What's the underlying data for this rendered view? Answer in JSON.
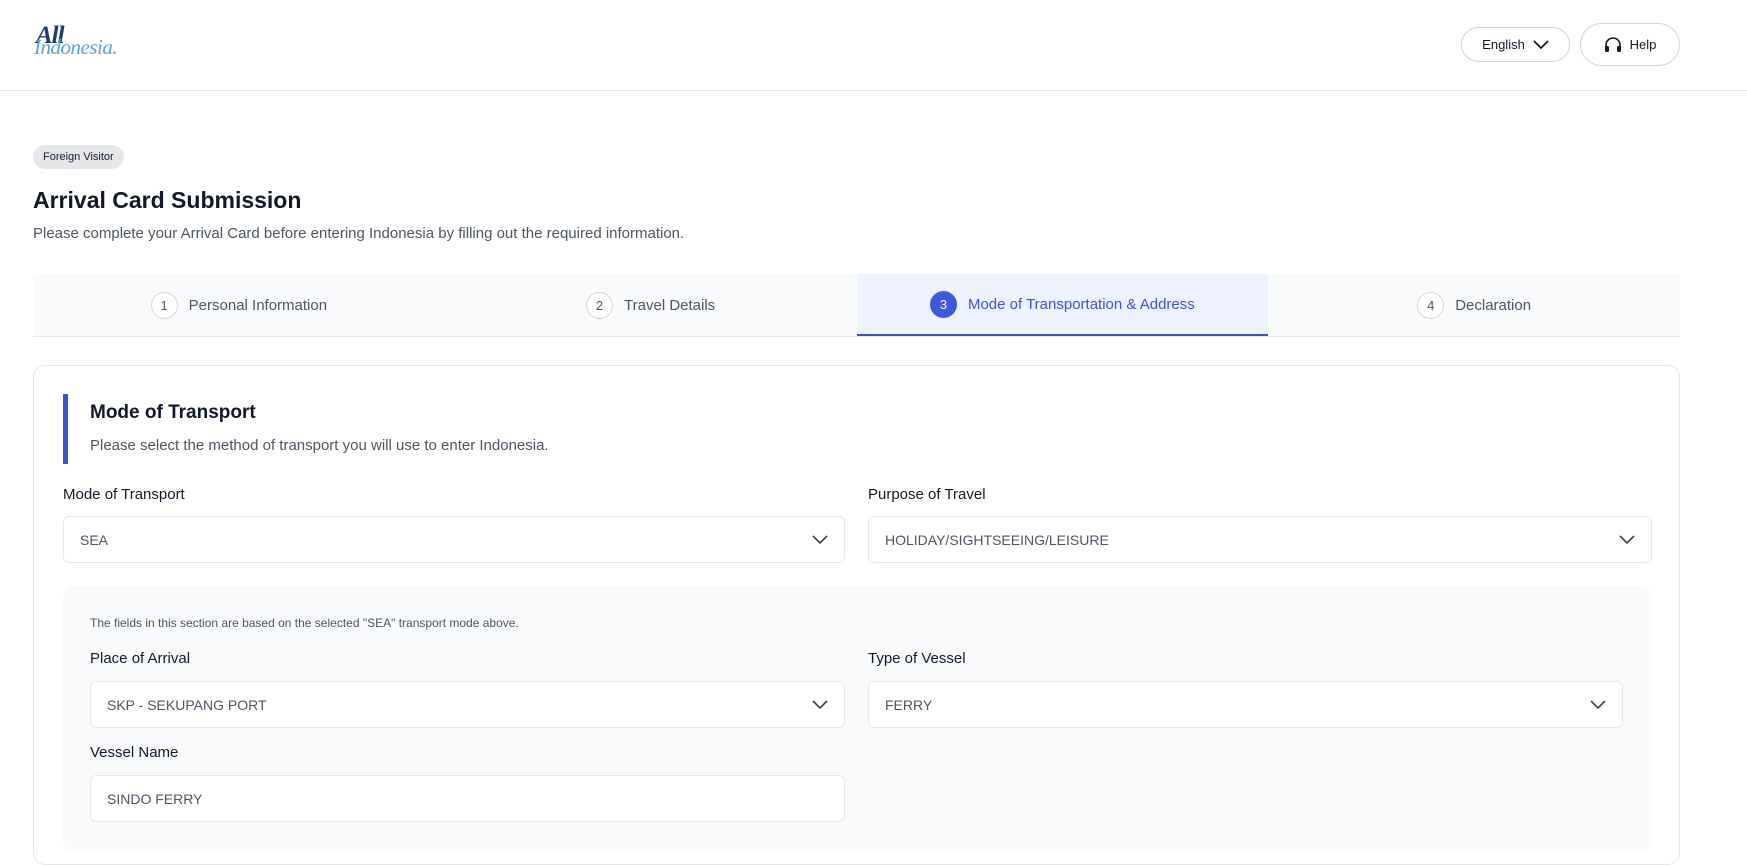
{
  "header": {
    "logo_all": "All",
    "logo_indonesia": "Indonesia.",
    "language_label": "English",
    "help_label": "Help"
  },
  "page": {
    "badge": "Foreign Visitor",
    "title": "Arrival Card Submission",
    "subtitle": "Please complete your Arrival Card before entering Indonesia by filling out the required information."
  },
  "steps": [
    {
      "num": "1",
      "label": "Personal Information"
    },
    {
      "num": "2",
      "label": "Travel Details"
    },
    {
      "num": "3",
      "label": "Mode of Transportation & Address"
    },
    {
      "num": "4",
      "label": "Declaration"
    }
  ],
  "active_step": 3,
  "section": {
    "title": "Mode of Transport",
    "subtitle": "Please select the method of transport you will use to enter Indonesia."
  },
  "fields": {
    "mode_of_transport": {
      "label": "Mode of Transport",
      "value": "SEA"
    },
    "purpose_of_travel": {
      "label": "Purpose of Travel",
      "value": "HOLIDAY/SIGHTSEEING/LEISURE"
    },
    "sea_note": "The fields in this section are based on the selected \"SEA\" transport mode above.",
    "place_of_arrival": {
      "label": "Place of Arrival",
      "value": "SKP - SEKUPANG PORT"
    },
    "type_of_vessel": {
      "label": "Type of Vessel",
      "value": "FERRY"
    },
    "vessel_name": {
      "label": "Vessel Name",
      "value": "SINDO FERRY"
    }
  },
  "colors": {
    "accent": "#3b55c8",
    "active_step_bg": "#eef2ff",
    "subpanel_bg": "#f8fafc"
  }
}
